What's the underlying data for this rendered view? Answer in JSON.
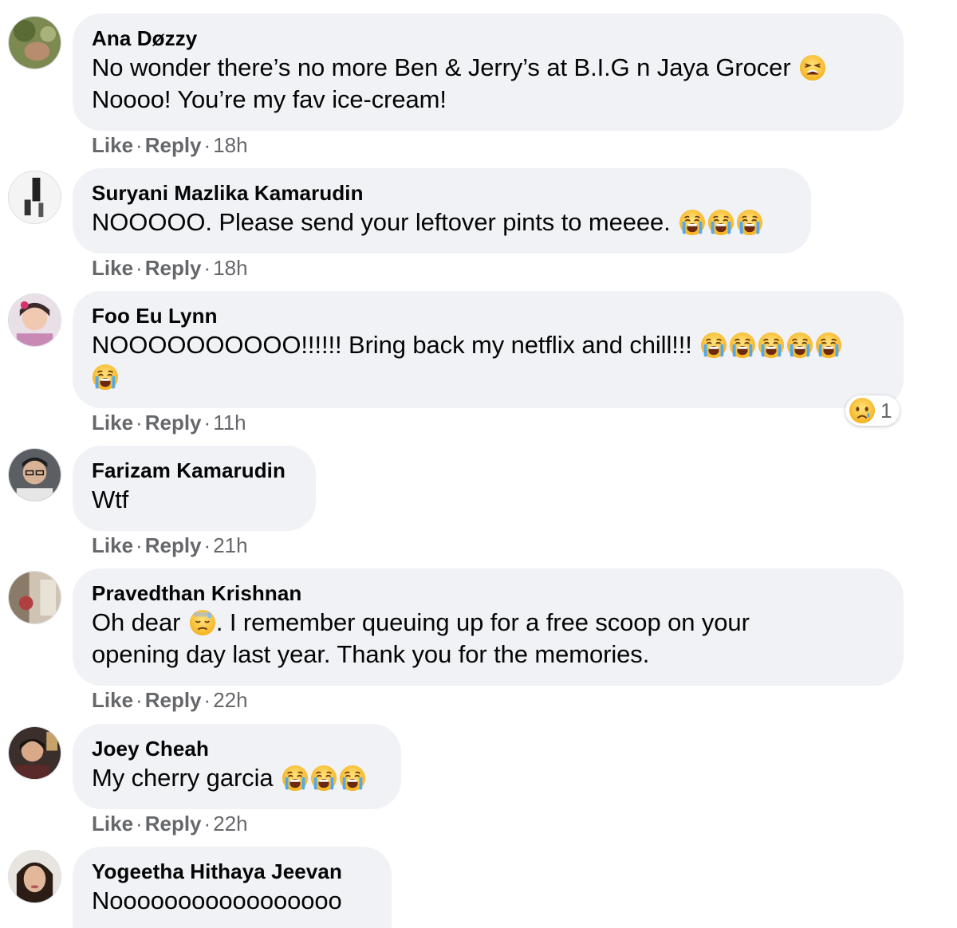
{
  "actions": {
    "like_label": "Like",
    "reply_label": "Reply",
    "separator": "·"
  },
  "colors": {
    "bubble_bg": "#f0f2f5",
    "text": "#050505",
    "meta": "#65676b"
  },
  "icons": {
    "tired_face": "tired-face-emoji-icon",
    "loudly_crying_face": "loudly-crying-face-emoji-icon",
    "downcast_sweat_face": "downcast-face-with-sweat-emoji-icon",
    "sad_reaction": "sad-reaction-icon"
  },
  "comments": [
    {
      "author": "Ana Døzzy",
      "text_line1": "No wonder there’s no more Ben & Jerry’s at B.I.G n Jaya Grocer",
      "text_line2": "Noooo! You’re my fav ice-cream!",
      "time": "18h"
    },
    {
      "author": "Suryani Mazlika Kamarudin",
      "text_line1": "NOOOOO. Please send your leftover pints to meeee.",
      "time": "18h"
    },
    {
      "author": "Foo Eu Lynn",
      "text_line1": "NOOOOOOOOOO!!!!!! Bring back my netflix and chill!!!",
      "time": "11h",
      "reaction_count": "1"
    },
    {
      "author": "Farizam Kamarudin",
      "text_line1": "Wtf",
      "time": "21h"
    },
    {
      "author": "Pravedthan Krishnan",
      "text_line1_a": "Oh dear",
      "text_line1_b": ". I remember queuing up for a free scoop on your",
      "text_line2": "opening day last year. Thank you for the memories.",
      "time": "22h"
    },
    {
      "author": "Joey Cheah",
      "text_line1": "My cherry garcia",
      "time": "22h"
    },
    {
      "author": "Yogeetha Hithaya Jeevan",
      "text_line1": "Nooooooooooooooooo"
    }
  ]
}
